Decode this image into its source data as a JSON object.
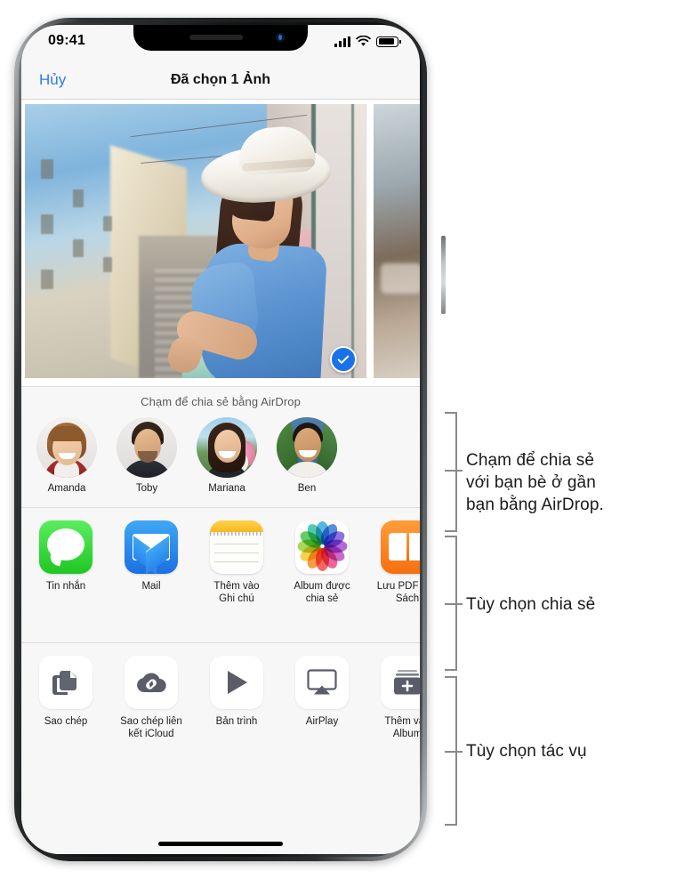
{
  "status_bar": {
    "time": "09:41",
    "signal_icon": "cellular-bars-icon",
    "wifi_icon": "wifi-icon",
    "battery_icon": "battery-icon"
  },
  "nav": {
    "cancel_label": "Hủy",
    "title": "Đã chọn 1 Ảnh"
  },
  "preview": {
    "photo_alt": "Người phụ nữ đội mũ trắng, mặc váy xanh đứng trên ban công",
    "selected": true,
    "check_icon": "checkmark-circle-icon"
  },
  "airdrop": {
    "hint": "Chạm để chia sẻ bằng AirDrop",
    "contacts": [
      {
        "name": "Amanda"
      },
      {
        "name": "Toby"
      },
      {
        "name": "Mariana"
      },
      {
        "name": "Ben"
      }
    ]
  },
  "share_apps": [
    {
      "label": "Tin nhắn",
      "icon": "messages-icon"
    },
    {
      "label": "Mail",
      "icon": "mail-icon"
    },
    {
      "label": "Thêm vào\nGhi chú",
      "icon": "notes-icon"
    },
    {
      "label": "Album được\nchia sẻ",
      "icon": "photos-icon"
    },
    {
      "label": "Lưu PDF\nvào Sách",
      "icon": "books-icon"
    }
  ],
  "actions": [
    {
      "label": "Sao chép",
      "icon": "copy-icon"
    },
    {
      "label": "Sao chép liên\nkết iCloud",
      "icon": "icloud-link-icon"
    },
    {
      "label": "Bản trình",
      "icon": "play-slideshow-icon"
    },
    {
      "label": "AirPlay",
      "icon": "airplay-icon"
    },
    {
      "label": "Thêm vào\nAlbum",
      "icon": "add-to-album-icon"
    }
  ],
  "callouts": [
    {
      "text": "Chạm để chia sẻ\nvới bạn bè ở gần\nbạn bằng AirDrop."
    },
    {
      "text": "Tùy chọn chia sẻ"
    },
    {
      "text": "Tùy chọn tác vụ"
    }
  ],
  "colors": {
    "accent_blue": "#2b7bf3",
    "check_blue": "#1a72e8",
    "sheet_bg": "#f7f7f7",
    "callout_line": "#8a8a8a"
  }
}
